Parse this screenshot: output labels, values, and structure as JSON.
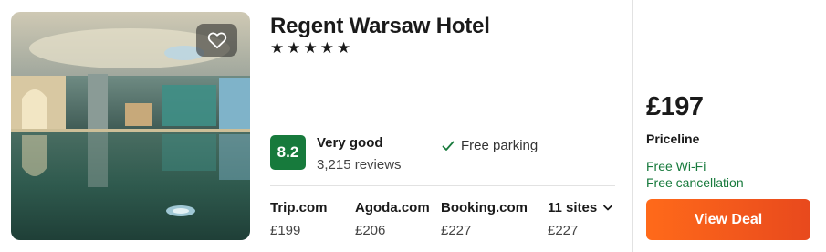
{
  "hotel": {
    "name": "Regent Warsaw Hotel",
    "stars": "★★★★★",
    "rating": {
      "score": "8.2",
      "label": "Very good",
      "reviews": "3,215 reviews"
    },
    "amenity": "Free parking",
    "icons": {
      "favorite": "heart-icon",
      "amenity": "checkmark-icon",
      "more_sites": "chevron-down-icon"
    }
  },
  "sites": [
    {
      "name": "Trip.com",
      "price": "£199"
    },
    {
      "name": "Agoda.com",
      "price": "£206"
    },
    {
      "name": "Booking.com",
      "price": "£227"
    },
    {
      "name": "11 sites",
      "price": "£227"
    }
  ],
  "deal": {
    "price": "£197",
    "provider": "Priceline",
    "perks": [
      "Free Wi-Fi",
      "Free cancellation"
    ],
    "button_label": "View Deal"
  },
  "colors": {
    "rating_badge": "#177a3c",
    "perk_text": "#177a3c",
    "deal_button": "#ff6a1a"
  }
}
